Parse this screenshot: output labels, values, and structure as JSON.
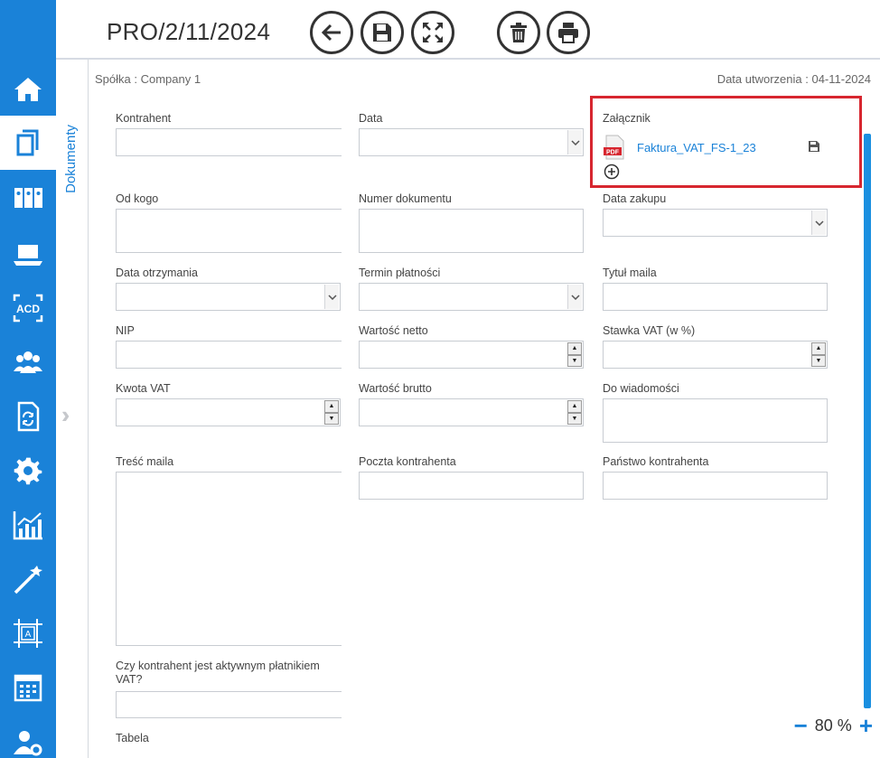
{
  "header": {
    "title": "PRO/2/11/2024"
  },
  "toolbar": {
    "buttons": [
      "back-icon",
      "save-icon",
      "fullscreen-icon",
      "delete-icon",
      "print-icon"
    ]
  },
  "sidebar": {
    "icons": [
      "home-icon",
      "documents-icon",
      "binders-icon",
      "laptop-icon",
      "acd-icon",
      "users-icon",
      "document-sync-icon",
      "gear-icon",
      "chart-icon",
      "magic-wand-icon",
      "template-icon",
      "calendar-icon",
      "user-settings-icon"
    ],
    "acd_text": "ACD",
    "template_letter": "A",
    "active_index": 1
  },
  "tab": {
    "label": "Dokumenty"
  },
  "meta": {
    "company": "Spółka : Company 1",
    "created": "Data utworzenia : 04-11-2024"
  },
  "fields": {
    "kontrahent": "Kontrahent",
    "data": "Data",
    "zalacznik": "Załącznik",
    "od_kogo": "Od kogo",
    "numer_dokumentu": "Numer dokumentu",
    "data_zakupu": "Data zakupu",
    "data_otrzymania": "Data otrzymania",
    "termin_platnosci": "Termin płatności",
    "tytul_maila": "Tytuł maila",
    "nip": "NIP",
    "wartosc_netto": "Wartość netto",
    "stawka_vat": "Stawka VAT (w %)",
    "kwota_vat": "Kwota VAT",
    "wartosc_brutto": "Wartość brutto",
    "do_wiadomosci": "Do wiadomości",
    "tresc_maila": "Treść maila",
    "poczta_kontrahenta": "Poczta kontrahenta",
    "panstwo_kontrahenta": "Państwo kontrahenta",
    "czy_aktywny": "Czy kontrahent jest aktywnym płatnikiem VAT?",
    "tabela": "Tabela"
  },
  "attachment": {
    "file_name": "Faktura_VAT_FS-1_23",
    "badge": "PDF"
  },
  "zoom": {
    "minus": "−",
    "value": "80 %",
    "plus": "+"
  },
  "colors": {
    "accent": "#1a82d8",
    "highlight": "#d7262f"
  }
}
